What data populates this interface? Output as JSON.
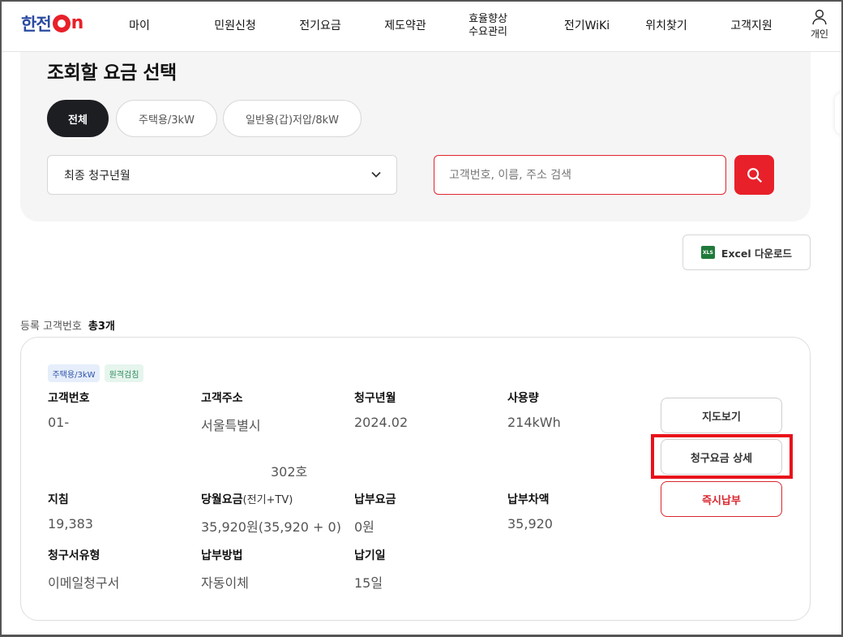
{
  "header": {
    "logo_text": "한전",
    "logo_on": "n",
    "nav": [
      "마이",
      "민원신청",
      "전기요금",
      "제도약관",
      "효율향상\n수요관리",
      "전기WiKi",
      "위치찾기",
      "고객지원"
    ],
    "user_label": "개인"
  },
  "search_panel": {
    "title": "조회할 요금 선택",
    "filters": [
      "전체",
      "주택용/3kW",
      "일반용(갑)저압/8kW"
    ],
    "select_value": "최종 청구년월",
    "search_placeholder": "고객번호, 이름, 주소 검색"
  },
  "excel_button": {
    "icon": "XLS",
    "label": "Excel 다운로드"
  },
  "summary": {
    "label": "등록 고객번호",
    "count": "총3개"
  },
  "card": {
    "badges": [
      "주택용/3kW",
      "원격검침"
    ],
    "fields": {
      "customer_no": {
        "label": "고객번호",
        "value": "01-"
      },
      "address": {
        "label": "고객주소",
        "value": "서울특별시",
        "value2": "302호"
      },
      "billing_month": {
        "label": "청구년월",
        "value": "2024.02"
      },
      "usage": {
        "label": "사용량",
        "value": "214kWh"
      },
      "reading": {
        "label": "지침",
        "value": "19,383"
      },
      "monthly_fee": {
        "label": "당월요금",
        "label_sub": "(전기+TV)",
        "value": "35,920원(35,920 + 0)"
      },
      "paid": {
        "label": "납부요금",
        "value": "0원"
      },
      "diff": {
        "label": "납부차액",
        "value": "35,920"
      },
      "bill_type": {
        "label": "청구서유형",
        "value": "이메일청구서"
      },
      "pay_method": {
        "label": "납부방법",
        "value": "자동이체"
      },
      "due_day": {
        "label": "납기일",
        "value": "15일"
      }
    },
    "actions": {
      "map": "지도보기",
      "bill_detail": "청구요금 상세",
      "pay_now": "즉시납부"
    }
  },
  "colors": {
    "brand_red": "#e8202a",
    "brand_blue": "#2b4aa0",
    "highlight": "#e8111b"
  }
}
